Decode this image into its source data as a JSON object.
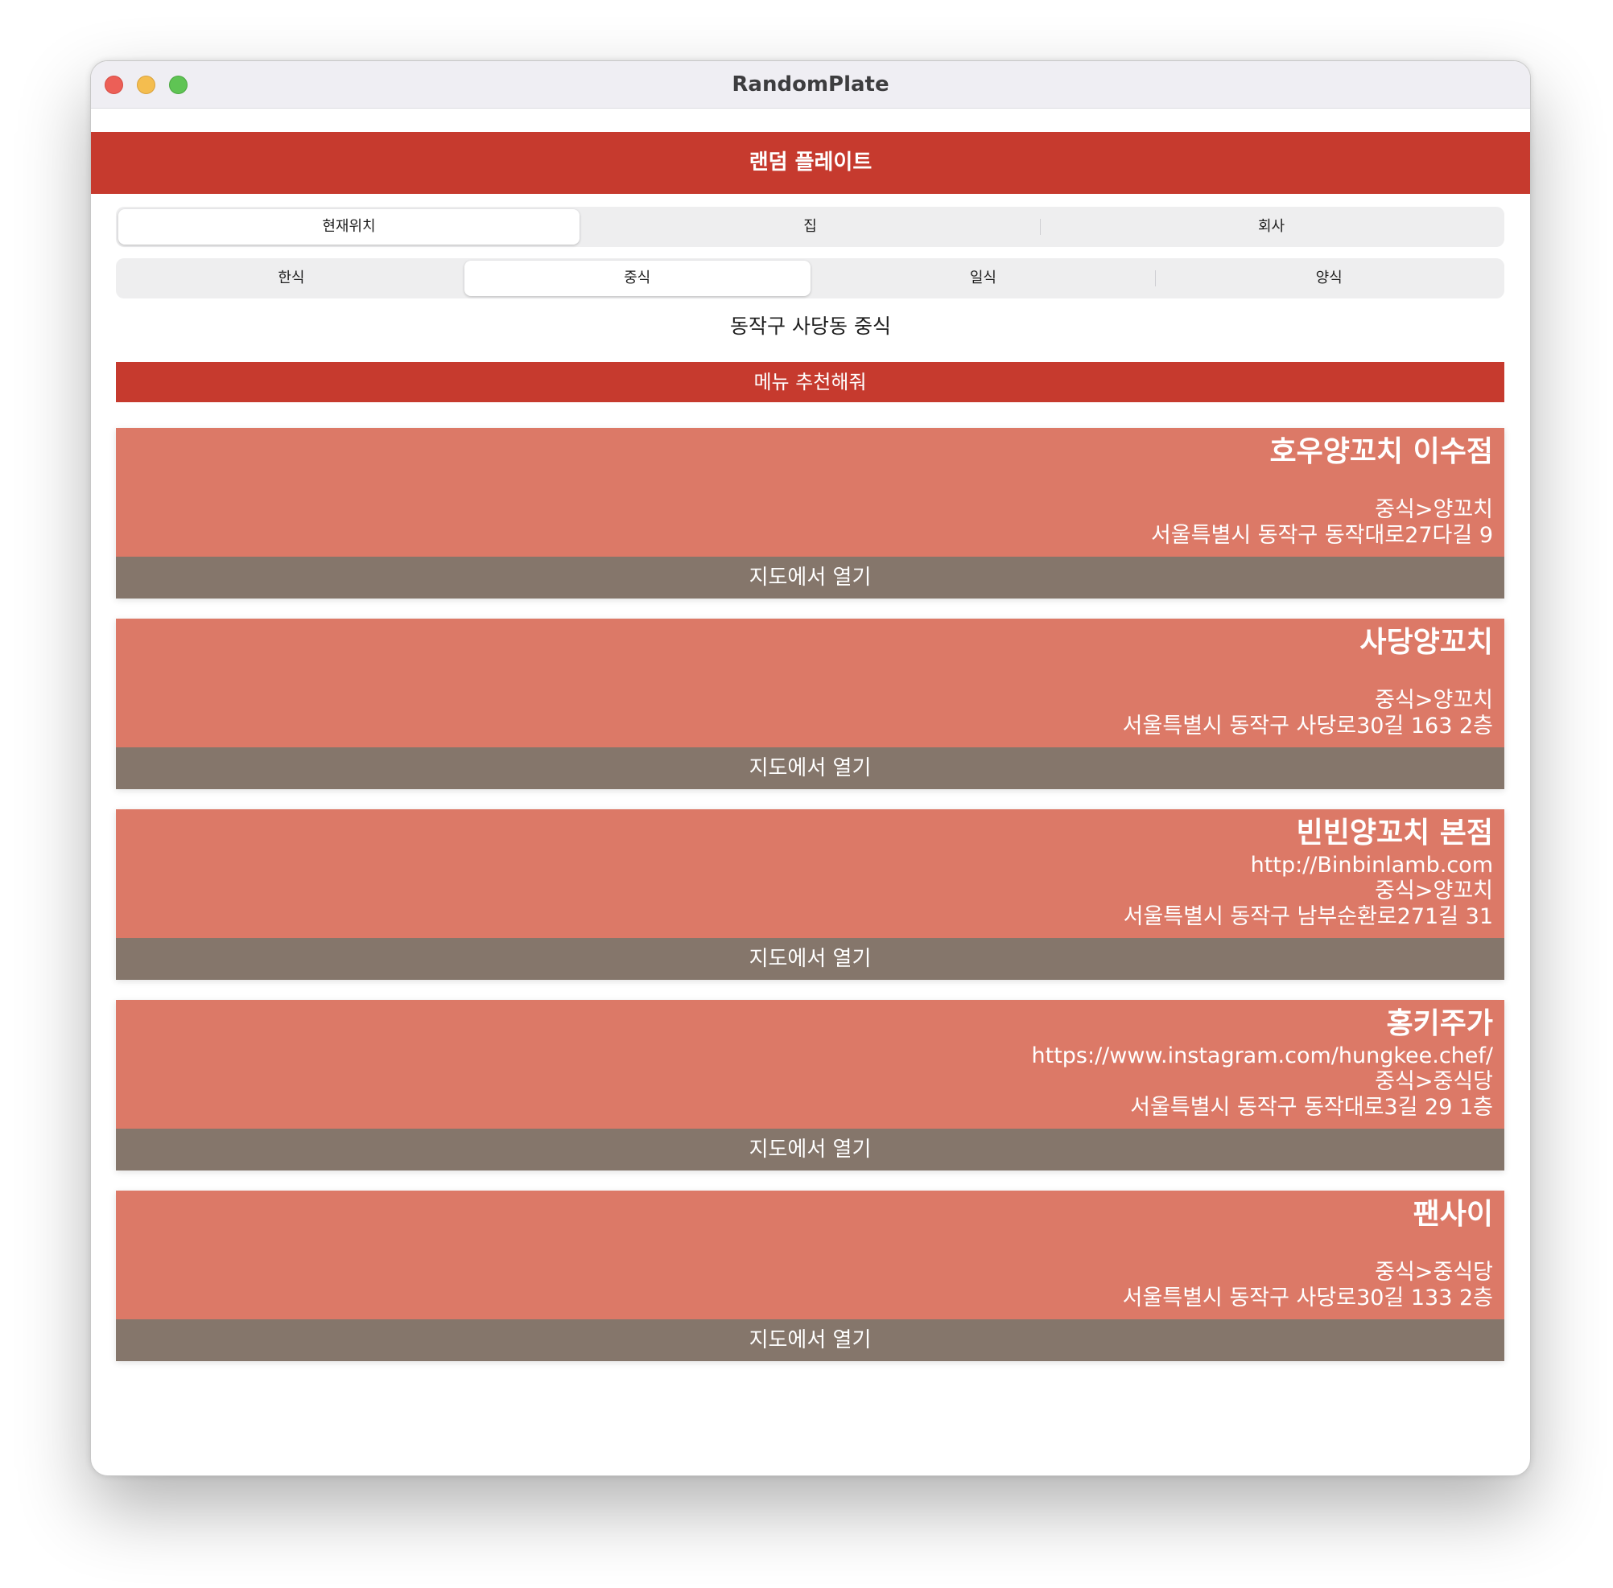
{
  "window": {
    "title": "RandomPlate"
  },
  "appbar": {
    "title": "랜덤 플레이트"
  },
  "location_tabs": [
    {
      "label": "현재위치",
      "selected": true
    },
    {
      "label": "집",
      "selected": false
    },
    {
      "label": "회사",
      "selected": false
    }
  ],
  "cuisine_tabs": [
    {
      "label": "한식",
      "selected": false
    },
    {
      "label": "중식",
      "selected": true
    },
    {
      "label": "일식",
      "selected": false
    },
    {
      "label": "양식",
      "selected": false
    }
  ],
  "location_text": "동작구 사당동 중식",
  "recommend_button": "메뉴 추천해줘",
  "map_button_label": "지도에서 열기",
  "restaurants": [
    {
      "name": "호우양꼬치 이수점",
      "url": "",
      "category": "중식>양꼬치",
      "address": "서울특별시 동작구 동작대로27다길 9"
    },
    {
      "name": "사당양꼬치",
      "url": "",
      "category": "중식>양꼬치",
      "address": "서울특별시 동작구 사당로30길 163 2층"
    },
    {
      "name": "빈빈양꼬치 본점",
      "url": "http://Binbinlamb.com",
      "category": "중식>양꼬치",
      "address": "서울특별시 동작구 남부순환로271길 31"
    },
    {
      "name": "홍키주가",
      "url": "https://www.instagram.com/hungkee.chef/",
      "category": "중식>중식당",
      "address": "서울특별시 동작구 동작대로3길 29 1층"
    },
    {
      "name": "팬사이",
      "url": "",
      "category": "중식>중식당",
      "address": "서울특별시 동작구 사당로30길 133 2층"
    }
  ],
  "colors": {
    "primary_red": "#c63a2e",
    "card_body": "#dc7967",
    "card_button": "#85766b"
  }
}
